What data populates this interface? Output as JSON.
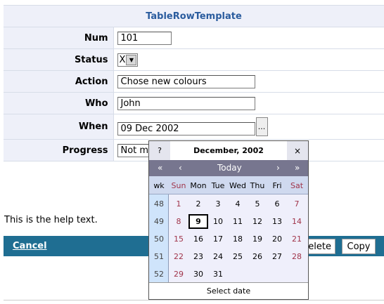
{
  "form": {
    "title": "TableRowTemplate",
    "rows": {
      "num": {
        "label": "Num",
        "value": "101"
      },
      "status": {
        "label": "Status",
        "value": "X"
      },
      "action": {
        "label": "Action",
        "value": "Chose new colours"
      },
      "who": {
        "label": "Who",
        "value": "John"
      },
      "when": {
        "label": "When",
        "value": "09 Dec 2002",
        "button": "..."
      },
      "progress": {
        "label": "Progress",
        "value": "Not mu"
      }
    }
  },
  "help_text": "This is the help text.",
  "footer": {
    "cancel": "Cancel",
    "delete": "elete",
    "copy": "Copy"
  },
  "calendar": {
    "help": "?",
    "title": "December, 2002",
    "close": "×",
    "nav": {
      "prev_year": "«",
      "prev_month": "‹",
      "today": "Today",
      "next_month": "›",
      "next_year": "»"
    },
    "week_header": "wk",
    "days": [
      "Sun",
      "Mon",
      "Tue",
      "Wed",
      "Thu",
      "Fri",
      "Sat"
    ],
    "weeks": [
      {
        "wk": "48",
        "dates": [
          "1",
          "2",
          "3",
          "4",
          "5",
          "6",
          "7"
        ]
      },
      {
        "wk": "49",
        "dates": [
          "8",
          "9",
          "10",
          "11",
          "12",
          "13",
          "14"
        ]
      },
      {
        "wk": "50",
        "dates": [
          "15",
          "16",
          "17",
          "18",
          "19",
          "20",
          "21"
        ]
      },
      {
        "wk": "51",
        "dates": [
          "22",
          "23",
          "24",
          "25",
          "26",
          "27",
          "28"
        ]
      },
      {
        "wk": "52",
        "dates": [
          "29",
          "30",
          "31",
          "",
          "",
          "",
          ""
        ]
      }
    ],
    "selected": "9",
    "status": "Select date"
  }
}
